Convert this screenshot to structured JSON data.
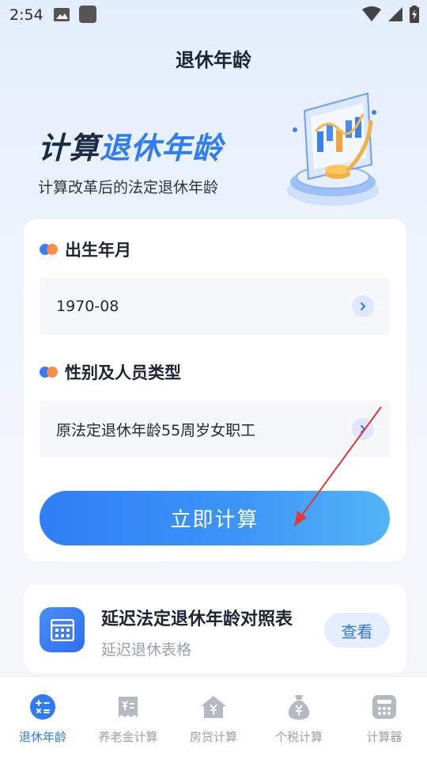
{
  "status_bar": {
    "time": "2:54"
  },
  "header": {
    "title": "退休年龄"
  },
  "hero": {
    "title_dark": "计算",
    "title_blue": "退休年龄",
    "subtitle": "计算改革后的法定退休年龄"
  },
  "form": {
    "birth_label": "出生年月",
    "birth_value": "1970-08",
    "type_label": "性别及人员类型",
    "type_value": "原法定退休年龄55周岁女职工",
    "submit_label": "立即计算"
  },
  "table_card": {
    "title": "延迟法定退休年龄对照表",
    "subtitle": "延迟退休表格",
    "button_label": "查看"
  },
  "tabs": [
    {
      "label": "退休年龄",
      "icon": "calculator-icon",
      "active": true
    },
    {
      "label": "养老金计算",
      "icon": "receipt-yuan-icon",
      "active": false
    },
    {
      "label": "房贷计算",
      "icon": "house-yuan-icon",
      "active": false
    },
    {
      "label": "个税计算",
      "icon": "money-bag-icon",
      "active": false
    },
    {
      "label": "计算器",
      "icon": "keypad-icon",
      "active": false
    }
  ],
  "colors": {
    "accent": "#2e7df6",
    "orange_dot": "#f98a3b",
    "tab_inactive": "#b4b9c2"
  }
}
